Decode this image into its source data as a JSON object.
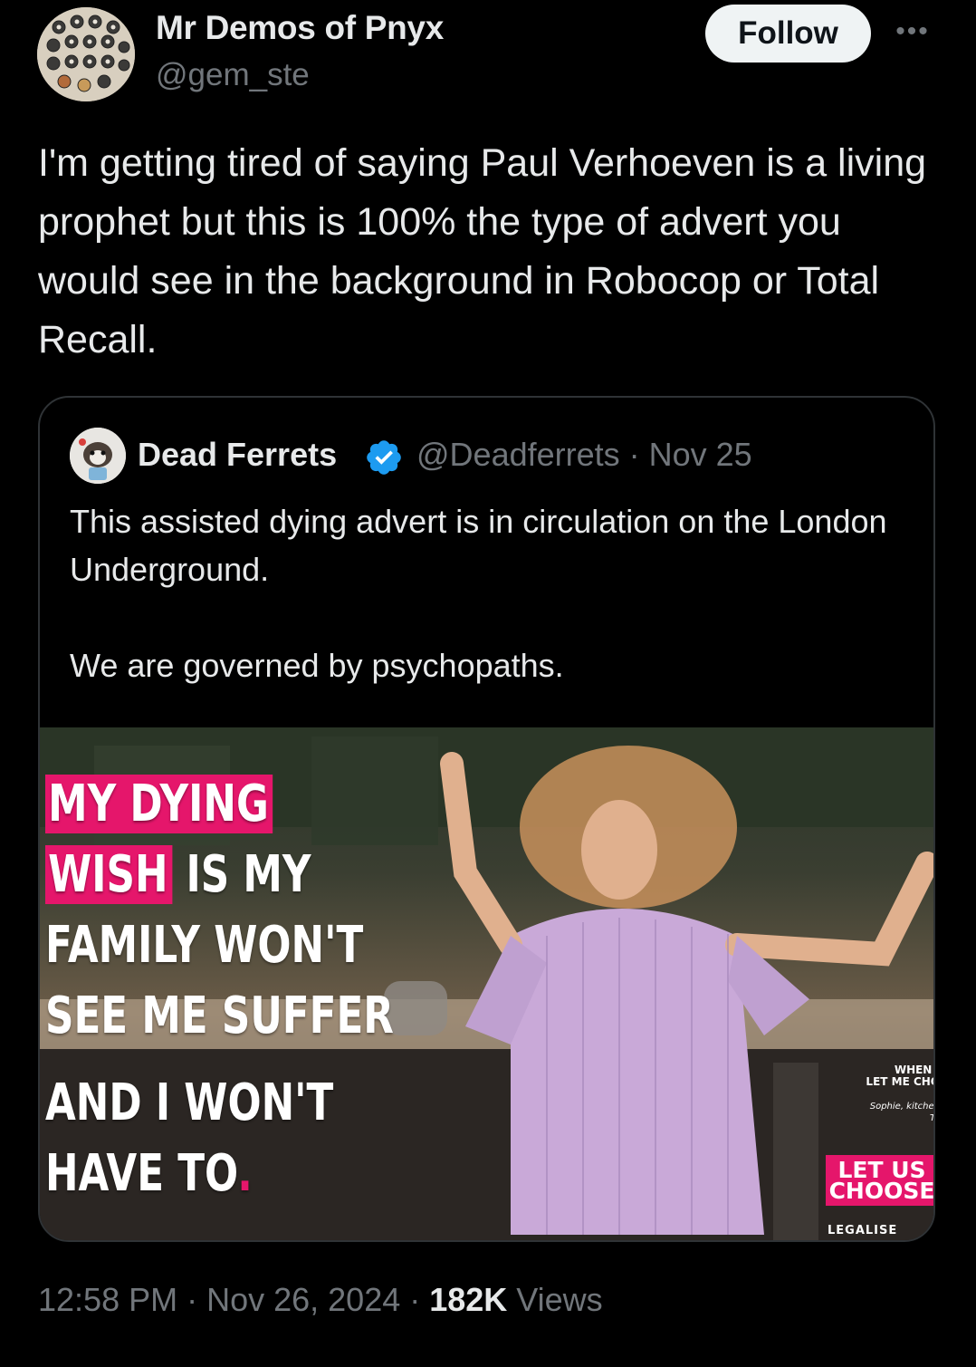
{
  "author": {
    "display_name": "Mr Demos of Pnyx",
    "handle": "@gem_ste",
    "avatar": "avatar-buttons-icon"
  },
  "follow_label": "Follow",
  "more_icon": "more-dots-icon",
  "tweet": {
    "text": "I'm getting tired of saying Paul Verhoeven is a living prophet but this is 100% the type of advert you would see in the background in Robocop or Total Recall."
  },
  "quote": {
    "display_name": "Dead Ferrets",
    "verified_icon": "verified-badge-icon",
    "handle_date": "@Deadferrets · Nov 25",
    "text_lines": [
      "This assisted dying advert is in circulation on the London Underground.",
      "",
      "We are governed by psychopaths."
    ],
    "image": {
      "headline_lines": [
        "MY DYING",
        "WISH",
        " IS MY",
        "FAMILY WON'T",
        "SEE ME SUFFER",
        "AND I WON'T",
        "HAVE TO",
        "."
      ],
      "side_text": "WHEN I\nLET ME CHO",
      "caption": "Sophie, kitchen\nTe",
      "cta": "LET US CHOOSE",
      "footer": "LEGALISE"
    }
  },
  "meta": {
    "time": "12:58 PM · Nov 26, 2024 · ",
    "views_count": "182K",
    "views_label": " Views"
  },
  "colors": {
    "background": "#000000",
    "text": "#e7e9ea",
    "muted": "#71767b",
    "verified": "#1d9bf0",
    "ad_pink": "#e5166b"
  }
}
